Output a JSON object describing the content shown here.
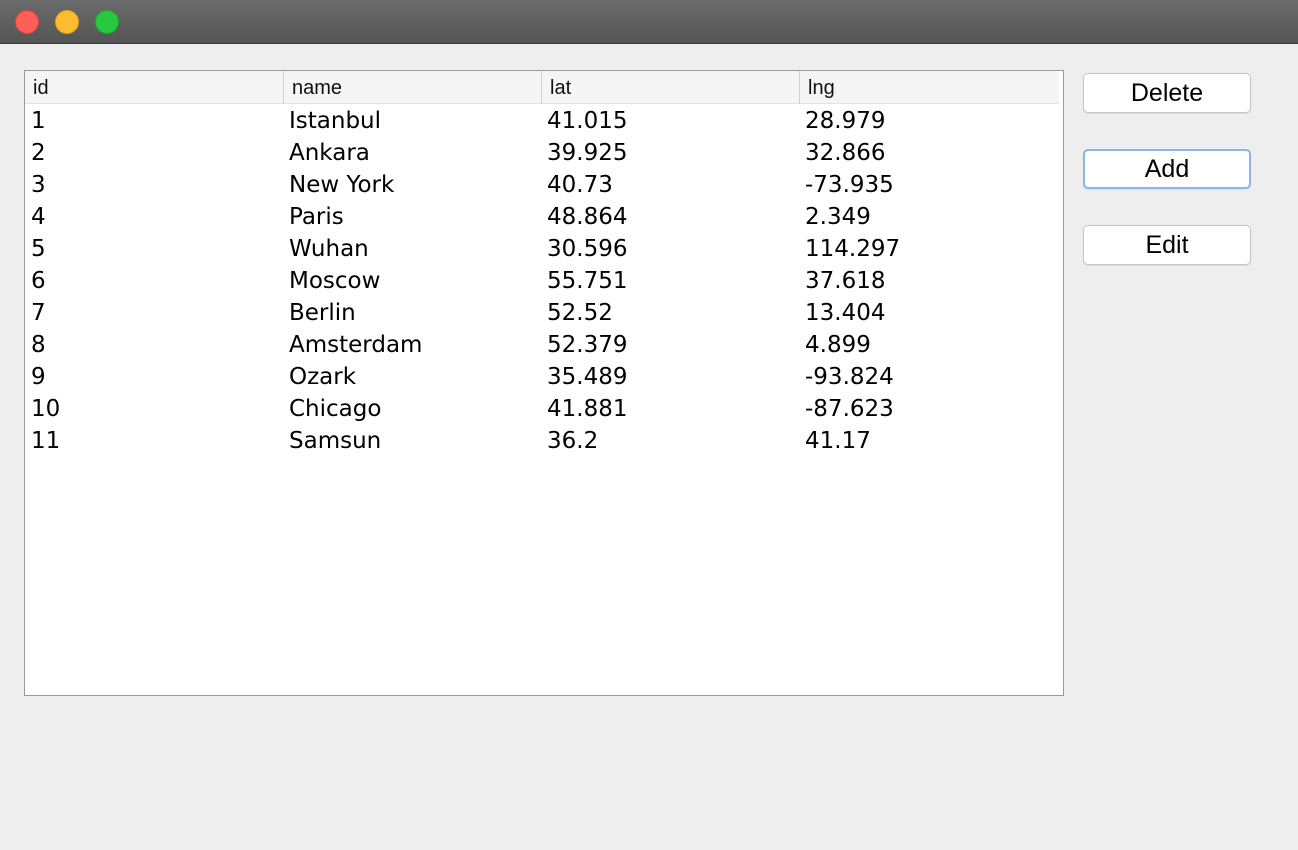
{
  "table": {
    "columns": [
      "id",
      "name",
      "lat",
      "lng"
    ],
    "rows": [
      [
        "1",
        "Istanbul",
        "41.015",
        "28.979"
      ],
      [
        "2",
        "Ankara",
        "39.925",
        "32.866"
      ],
      [
        "3",
        "New York",
        "40.73",
        "-73.935"
      ],
      [
        "4",
        "Paris",
        "48.864",
        "2.349"
      ],
      [
        "5",
        "Wuhan",
        "30.596",
        "114.297"
      ],
      [
        "6",
        "Moscow",
        "55.751",
        "37.618"
      ],
      [
        "7",
        "Berlin",
        "52.52",
        "13.404"
      ],
      [
        "8",
        "Amsterdam",
        "52.379",
        "4.899"
      ],
      [
        "9",
        "Ozark",
        "35.489",
        "-93.824"
      ],
      [
        "10",
        "Chicago",
        "41.881",
        "-87.623"
      ],
      [
        "11",
        "Samsun",
        "36.2",
        "41.17"
      ]
    ]
  },
  "buttons": {
    "delete_label": "Delete",
    "add_label": "Add",
    "edit_label": "Edit"
  },
  "colors": {
    "close": "#fe5f57",
    "minimize": "#febc2e",
    "zoom": "#28c840",
    "focus_ring": "#8cb6e8"
  }
}
